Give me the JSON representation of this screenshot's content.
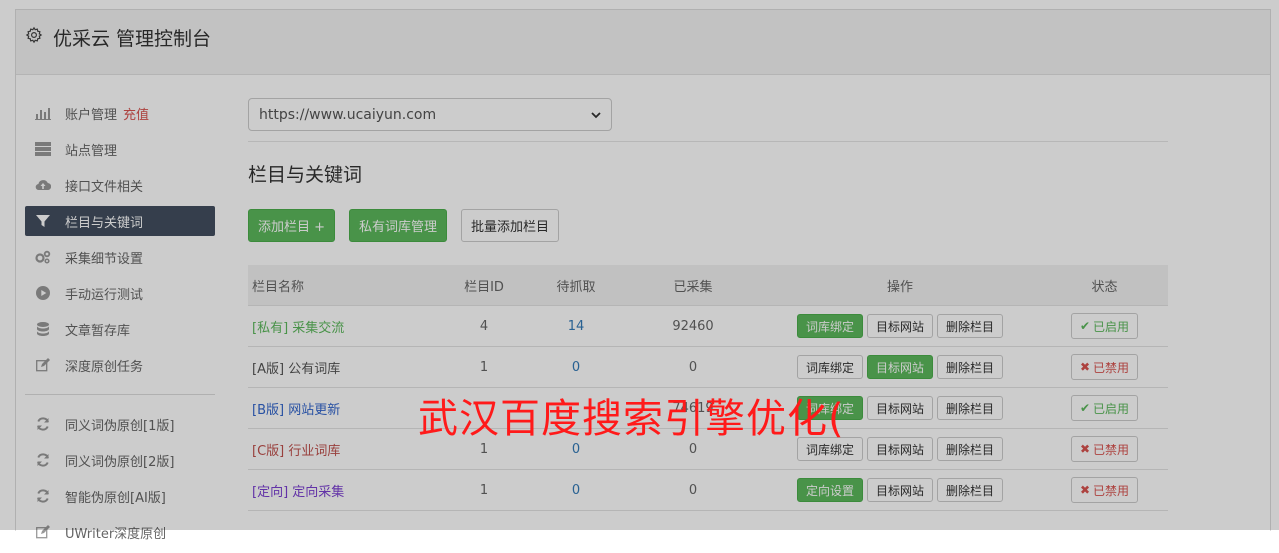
{
  "header": {
    "title": "优采云 管理控制台"
  },
  "sidebar": {
    "items": [
      {
        "label": "账户管理",
        "extra": "充值",
        "icon": "bar-chart-icon"
      },
      {
        "label": "站点管理",
        "icon": "server-icon"
      },
      {
        "label": "接口文件相关",
        "icon": "cloud-upload-icon"
      },
      {
        "label": "栏目与关键词",
        "icon": "filter-icon",
        "active": true
      },
      {
        "label": "采集细节设置",
        "icon": "gears-icon"
      },
      {
        "label": "手动运行测试",
        "icon": "play-circle-icon"
      },
      {
        "label": "文章暂存库",
        "icon": "database-icon"
      },
      {
        "label": "深度原创任务",
        "icon": "edit-icon"
      }
    ],
    "items2": [
      {
        "label": "同义词伪原创[1版]",
        "icon": "refresh-icon"
      },
      {
        "label": "同义词伪原创[2版]",
        "icon": "refresh-icon"
      },
      {
        "label": "智能伪原创[AI版]",
        "icon": "refresh-icon"
      },
      {
        "label": "UWriter深度原创",
        "icon": "edit-icon"
      }
    ]
  },
  "main": {
    "site_select": "https://www.ucaiyun.com",
    "section_title": "栏目与关键词",
    "buttons": {
      "add_column": "添加栏目 +",
      "private_lib": "私有词库管理",
      "batch_add": "批量添加栏目"
    },
    "table": {
      "headers": [
        "栏目名称",
        "栏目ID",
        "待抓取",
        "已采集",
        "操作",
        "状态"
      ],
      "rows": [
        {
          "tag": "[私有]",
          "name": "采集交流",
          "tag_color": "#5cb85c",
          "id": "4",
          "pending": "14",
          "collected": "92460",
          "op1": "词库绑定",
          "op1_green": true,
          "op2": "目标网站",
          "op2_green": false,
          "op3": "删除栏目",
          "status": "已启用",
          "enabled": true
        },
        {
          "tag": "[A版]",
          "name": "公有词库",
          "tag_color": "#555555",
          "id": "1",
          "pending": "0",
          "collected": "0",
          "op1": "词库绑定",
          "op1_green": false,
          "op2": "目标网站",
          "op2_green": true,
          "op3": "删除栏目",
          "status": "已禁用",
          "enabled": false
        },
        {
          "tag": "[B版]",
          "name": "网站更新",
          "tag_color": "#3366cc",
          "id": "",
          "pending": "",
          "collected": "74619",
          "op1": "词库绑定",
          "op1_green": true,
          "op2": "目标网站",
          "op2_green": false,
          "op3": "删除栏目",
          "status": "已启用",
          "enabled": true
        },
        {
          "tag": "[C版]",
          "name": "行业词库",
          "tag_color": "#c0504d",
          "id": "1",
          "pending": "0",
          "collected": "0",
          "op1": "词库绑定",
          "op1_green": false,
          "op2": "目标网站",
          "op2_green": false,
          "op3": "删除栏目",
          "status": "已禁用",
          "enabled": false
        },
        {
          "tag": "[定向]",
          "name": "定向采集",
          "tag_color": "#7b3fd1",
          "id": "1",
          "pending": "0",
          "collected": "0",
          "op1": "定向设置",
          "op1_green": true,
          "op2": "目标网站",
          "op2_green": false,
          "op3": "删除栏目",
          "status": "已禁用",
          "enabled": false
        }
      ]
    }
  },
  "watermark": "武汉百度搜索引擎优化("
}
